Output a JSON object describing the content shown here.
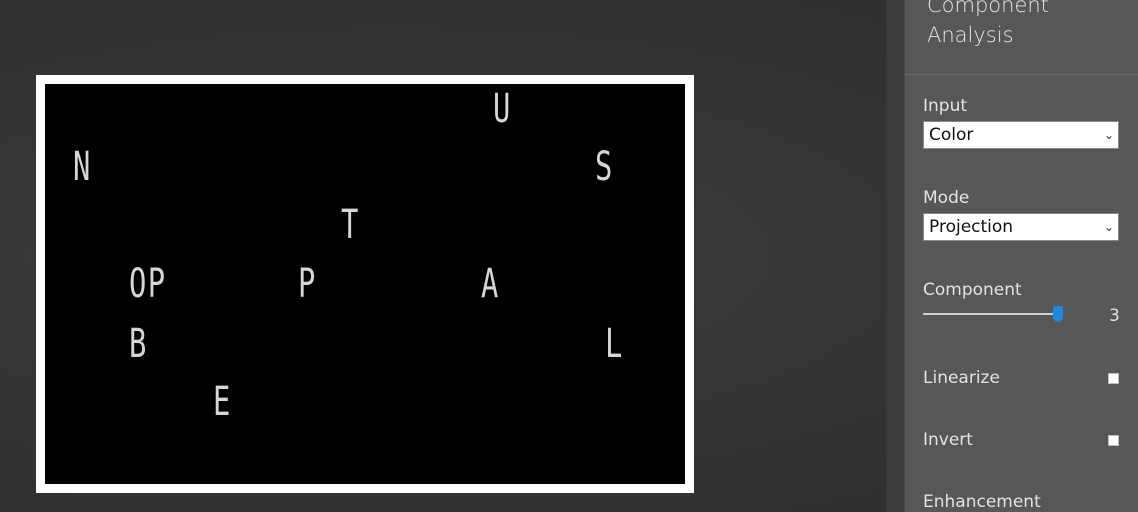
{
  "panel": {
    "title": "Component Analysis",
    "input": {
      "label": "Input",
      "value": "Color"
    },
    "mode": {
      "label": "Mode",
      "value": "Projection"
    },
    "component": {
      "label": "Component",
      "value": "3",
      "fraction": 1.0
    },
    "linearize": {
      "label": "Linearize",
      "checked": false
    },
    "invert": {
      "label": "Invert",
      "checked": false
    },
    "enhancement": {
      "label": "Enhancement"
    }
  },
  "image": {
    "glyphs": [
      "U",
      "N",
      "S",
      "T",
      "OP",
      "P",
      "A",
      "B",
      "L",
      "E"
    ]
  },
  "colors": {
    "accent": "#1e88e5",
    "panel_bg": "#575757",
    "image_bg": "#000000"
  }
}
